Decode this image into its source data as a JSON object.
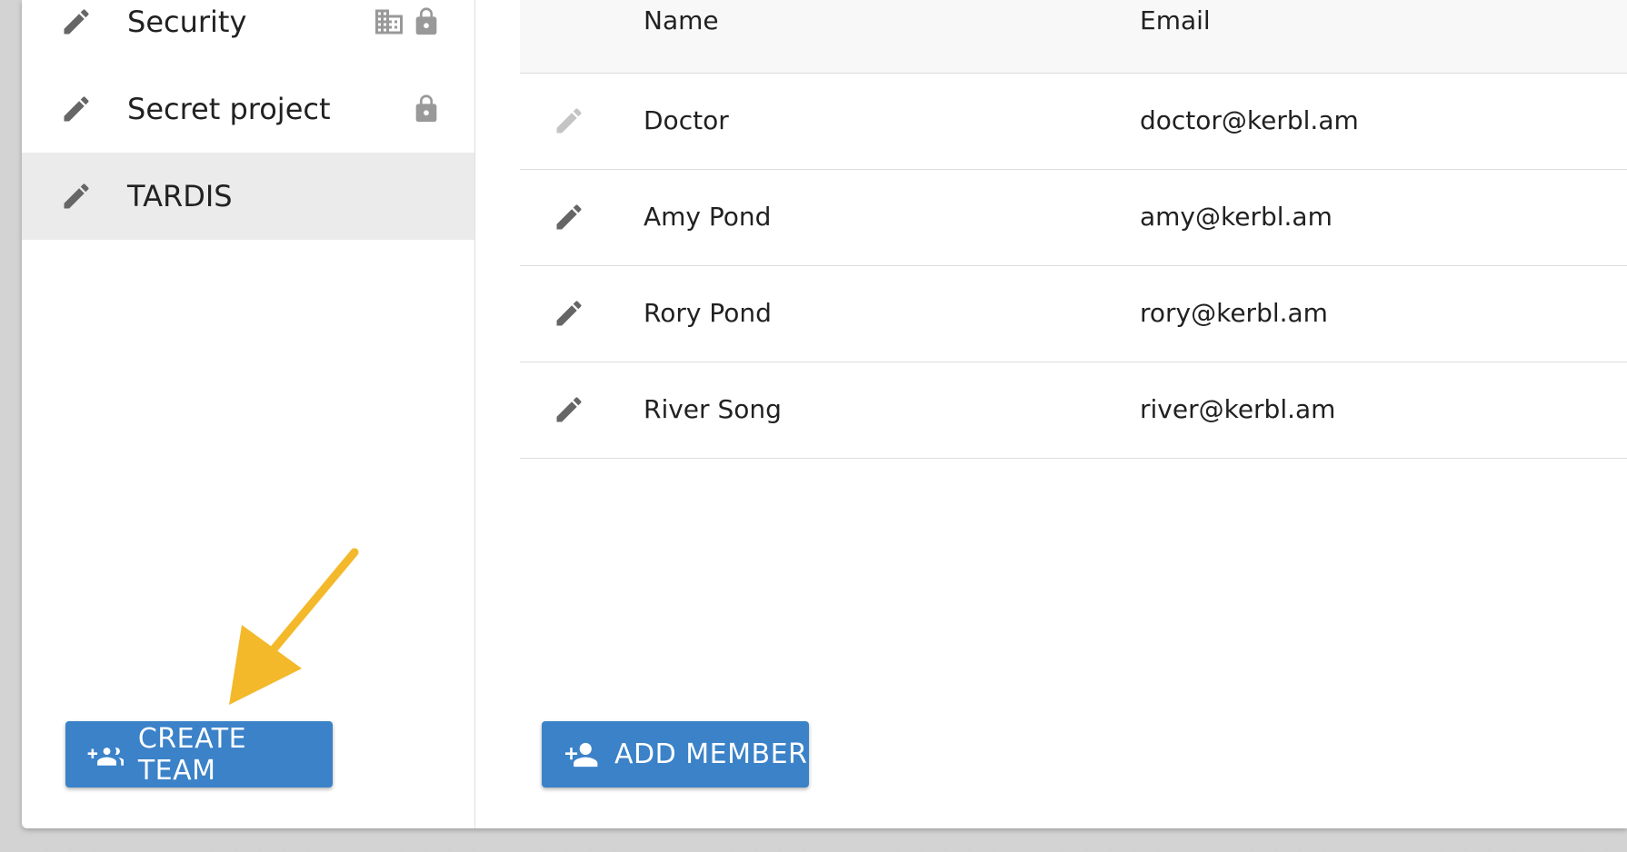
{
  "sidebar": {
    "teams": [
      {
        "label": "Security",
        "icons": [
          "building-icon",
          "lock-icon"
        ]
      },
      {
        "label": "Secret project",
        "icons": [
          "lock-icon"
        ]
      },
      {
        "label": "TARDIS",
        "icons": [],
        "selected": true
      }
    ],
    "create_button": {
      "label": "CREATE TEAM",
      "icon": "add-group-icon"
    }
  },
  "members_table": {
    "columns": [
      "Name",
      "Email"
    ],
    "rows": [
      {
        "name": "Doctor",
        "email": "doctor@kerbl.am",
        "edit_disabled": true
      },
      {
        "name": "Amy Pond",
        "email": "amy@kerbl.am",
        "edit_disabled": false
      },
      {
        "name": "Rory Pond",
        "email": "rory@kerbl.am",
        "edit_disabled": false
      },
      {
        "name": "River Song",
        "email": "river@kerbl.am",
        "edit_disabled": false
      }
    ],
    "add_button": {
      "label": "ADD MEMBER",
      "icon": "add-person-icon"
    }
  },
  "colors": {
    "accent": "#3b82c8",
    "annotation_arrow": "#f3b92b",
    "selected_row": "#ebebeb",
    "icon": "#666666",
    "icon_disabled": "#c4c4c4"
  }
}
